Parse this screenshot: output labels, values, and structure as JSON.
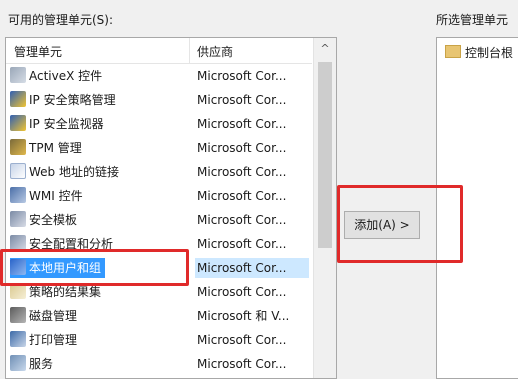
{
  "labels": {
    "available": "可用的管理单元(S):",
    "selected": "所选管理单元"
  },
  "list": {
    "col_name": "管理单元",
    "col_vendor": "供应商",
    "items": [
      {
        "name": "ActiveX 控件",
        "vendor": "Microsoft Cor...",
        "icon": "activex-icon",
        "icon_class": "i-activex"
      },
      {
        "name": "IP 安全策略管理",
        "vendor": "Microsoft Cor...",
        "icon": "shield-icon",
        "icon_class": "i-shield"
      },
      {
        "name": "IP 安全监视器",
        "vendor": "Microsoft Cor...",
        "icon": "shield-icon",
        "icon_class": "i-shield"
      },
      {
        "name": "TPM 管理",
        "vendor": "Microsoft Cor...",
        "icon": "tpm-chip-icon",
        "icon_class": "i-tpm"
      },
      {
        "name": "Web 地址的链接",
        "vendor": "Microsoft Cor...",
        "icon": "web-link-icon",
        "icon_class": "i-web"
      },
      {
        "name": "WMI 控件",
        "vendor": "Microsoft Cor...",
        "icon": "wmi-icon",
        "icon_class": "i-wmi"
      },
      {
        "name": "安全模板",
        "vendor": "Microsoft Cor...",
        "icon": "security-template-icon",
        "icon_class": "i-sec"
      },
      {
        "name": "安全配置和分析",
        "vendor": "Microsoft Cor...",
        "icon": "security-analysis-icon",
        "icon_class": "i-sec"
      },
      {
        "name": "本地用户和组",
        "vendor": "Microsoft Cor...",
        "icon": "users-icon",
        "icon_class": "i-users",
        "selected": true
      },
      {
        "name": "策略的结果集",
        "vendor": "Microsoft Cor...",
        "icon": "policy-icon",
        "icon_class": "i-policy"
      },
      {
        "name": "磁盘管理",
        "vendor": "Microsoft 和 V...",
        "icon": "disk-icon",
        "icon_class": "i-disk"
      },
      {
        "name": "打印管理",
        "vendor": "Microsoft Cor...",
        "icon": "printer-icon",
        "icon_class": "i-print"
      },
      {
        "name": "服务",
        "vendor": "Microsoft Cor...",
        "icon": "gear-icon",
        "icon_class": "i-svc"
      }
    ]
  },
  "scroll_up_glyph": "^",
  "add_button": "添加(A) >",
  "selected_items": [
    {
      "name": "控制台根",
      "icon": "folder-icon"
    }
  ],
  "colors": {
    "selection": "#3399ff",
    "highlight_box": "#e02a2a"
  }
}
